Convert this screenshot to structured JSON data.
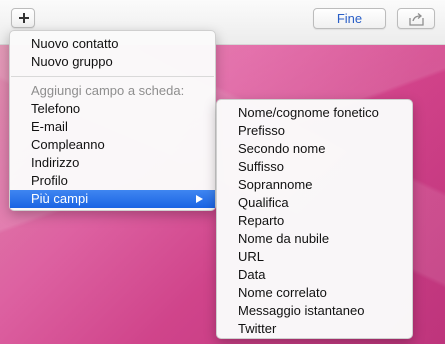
{
  "toolbar": {
    "add_icon": "plus-icon",
    "done_label": "Fine",
    "share_icon": "share-icon"
  },
  "main_menu": {
    "items": [
      {
        "label": "Nuovo contatto"
      },
      {
        "label": "Nuovo gruppo"
      }
    ],
    "section_header": "Aggiungi campo a scheda:",
    "fields": [
      {
        "label": "Telefono"
      },
      {
        "label": "E-mail"
      },
      {
        "label": "Compleanno"
      },
      {
        "label": "Indirizzo"
      },
      {
        "label": "Profilo"
      }
    ],
    "more_fields": {
      "label": "Più campi",
      "selected": true
    }
  },
  "sub_menu": {
    "items": [
      {
        "label": "Nome/cognome fonetico"
      },
      {
        "label": "Prefisso"
      },
      {
        "label": "Secondo nome"
      },
      {
        "label": "Suffisso"
      },
      {
        "label": "Soprannome"
      },
      {
        "label": "Qualifica"
      },
      {
        "label": "Reparto"
      },
      {
        "label": "Nome da nubile"
      },
      {
        "label": "URL"
      },
      {
        "label": "Data"
      },
      {
        "label": "Nome correlato"
      },
      {
        "label": "Messaggio istantaneo"
      },
      {
        "label": "Twitter"
      }
    ]
  },
  "colors": {
    "highlight": "#1f6fe8",
    "header_text": "#8e8e8e",
    "done_text": "#2a5fc7",
    "wallpaper": "#d2438a"
  }
}
